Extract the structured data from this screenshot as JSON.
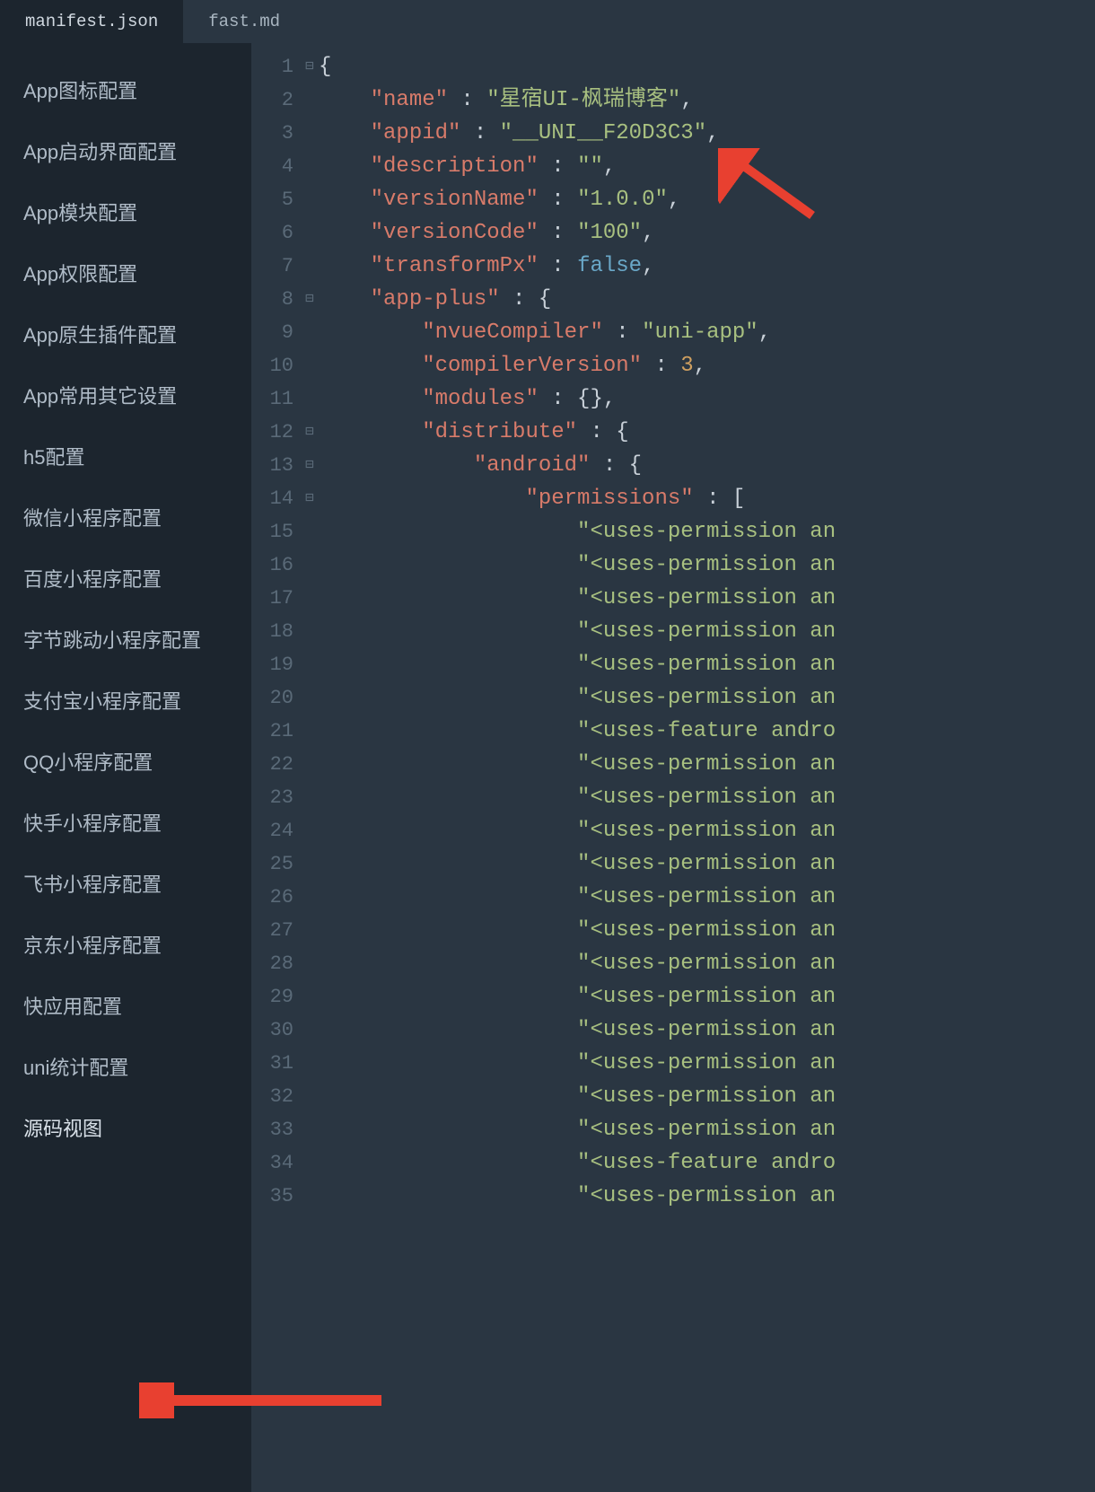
{
  "tabs": [
    {
      "label": "manifest.json",
      "active": true
    },
    {
      "label": "fast.md",
      "active": false
    }
  ],
  "sidebar": {
    "items": [
      "App图标配置",
      "App启动界面配置",
      "App模块配置",
      "App权限配置",
      "App原生插件配置",
      "App常用其它设置",
      "h5配置",
      "微信小程序配置",
      "百度小程序配置",
      "字节跳动小程序配置",
      "支付宝小程序配置",
      "QQ小程序配置",
      "快手小程序配置",
      "飞书小程序配置",
      "京东小程序配置",
      "快应用配置",
      "uni统计配置",
      "源码视图"
    ],
    "active_index": 17
  },
  "code": {
    "lines": [
      {
        "n": 1,
        "fold": "⊟",
        "indent": 0,
        "t": [
          {
            "c": "cp",
            "v": "{"
          }
        ]
      },
      {
        "n": 2,
        "indent": 1,
        "t": [
          {
            "c": "ck",
            "v": "\"name\""
          },
          {
            "c": "cp",
            "v": " : "
          },
          {
            "c": "cs",
            "v": "\"星宿UI-枫瑞博客\""
          },
          {
            "c": "cp",
            "v": ","
          }
        ]
      },
      {
        "n": 3,
        "indent": 1,
        "t": [
          {
            "c": "ck",
            "v": "\"appid\""
          },
          {
            "c": "cp",
            "v": " : "
          },
          {
            "c": "cs",
            "v": "\"__UNI__F20D3C3\""
          },
          {
            "c": "cp",
            "v": ","
          }
        ]
      },
      {
        "n": 4,
        "indent": 1,
        "t": [
          {
            "c": "ck",
            "v": "\"description\""
          },
          {
            "c": "cp",
            "v": " : "
          },
          {
            "c": "cs",
            "v": "\"\""
          },
          {
            "c": "cp",
            "v": ","
          }
        ]
      },
      {
        "n": 5,
        "indent": 1,
        "t": [
          {
            "c": "ck",
            "v": "\"versionName\""
          },
          {
            "c": "cp",
            "v": " : "
          },
          {
            "c": "cs",
            "v": "\"1.0.0\""
          },
          {
            "c": "cp",
            "v": ","
          }
        ]
      },
      {
        "n": 6,
        "indent": 1,
        "t": [
          {
            "c": "ck",
            "v": "\"versionCode\""
          },
          {
            "c": "cp",
            "v": " : "
          },
          {
            "c": "cs",
            "v": "\"100\""
          },
          {
            "c": "cp",
            "v": ","
          }
        ]
      },
      {
        "n": 7,
        "indent": 1,
        "t": [
          {
            "c": "ck",
            "v": "\"transformPx\""
          },
          {
            "c": "cp",
            "v": " : "
          },
          {
            "c": "cb",
            "v": "false"
          },
          {
            "c": "cp",
            "v": ","
          }
        ]
      },
      {
        "n": 8,
        "fold": "⊟",
        "indent": 1,
        "t": [
          {
            "c": "ck",
            "v": "\"app-plus\""
          },
          {
            "c": "cp",
            "v": " : {"
          }
        ]
      },
      {
        "n": 9,
        "indent": 2,
        "t": [
          {
            "c": "ck",
            "v": "\"nvueCompiler\""
          },
          {
            "c": "cp",
            "v": " : "
          },
          {
            "c": "cs",
            "v": "\"uni-app\""
          },
          {
            "c": "cp",
            "v": ","
          }
        ]
      },
      {
        "n": 10,
        "indent": 2,
        "t": [
          {
            "c": "ck",
            "v": "\"compilerVersion\""
          },
          {
            "c": "cp",
            "v": " : "
          },
          {
            "c": "cn",
            "v": "3"
          },
          {
            "c": "cp",
            "v": ","
          }
        ]
      },
      {
        "n": 11,
        "indent": 2,
        "t": [
          {
            "c": "ck",
            "v": "\"modules\""
          },
          {
            "c": "cp",
            "v": " : {},"
          }
        ]
      },
      {
        "n": 12,
        "fold": "⊟",
        "indent": 2,
        "t": [
          {
            "c": "ck",
            "v": "\"distribute\""
          },
          {
            "c": "cp",
            "v": " : {"
          }
        ]
      },
      {
        "n": 13,
        "fold": "⊟",
        "indent": 3,
        "t": [
          {
            "c": "ck",
            "v": "\"android\""
          },
          {
            "c": "cp",
            "v": " : {"
          }
        ]
      },
      {
        "n": 14,
        "fold": "⊟",
        "indent": 4,
        "t": [
          {
            "c": "ck",
            "v": "\"permissions\""
          },
          {
            "c": "cp",
            "v": " : ["
          }
        ]
      },
      {
        "n": 15,
        "indent": 5,
        "t": [
          {
            "c": "cs",
            "v": "\"<uses-permission an"
          }
        ]
      },
      {
        "n": 16,
        "indent": 5,
        "t": [
          {
            "c": "cs",
            "v": "\"<uses-permission an"
          }
        ]
      },
      {
        "n": 17,
        "indent": 5,
        "t": [
          {
            "c": "cs",
            "v": "\"<uses-permission an"
          }
        ]
      },
      {
        "n": 18,
        "indent": 5,
        "t": [
          {
            "c": "cs",
            "v": "\"<uses-permission an"
          }
        ]
      },
      {
        "n": 19,
        "indent": 5,
        "t": [
          {
            "c": "cs",
            "v": "\"<uses-permission an"
          }
        ]
      },
      {
        "n": 20,
        "indent": 5,
        "t": [
          {
            "c": "cs",
            "v": "\"<uses-permission an"
          }
        ]
      },
      {
        "n": 21,
        "indent": 5,
        "t": [
          {
            "c": "cs",
            "v": "\"<uses-feature andro"
          }
        ]
      },
      {
        "n": 22,
        "indent": 5,
        "t": [
          {
            "c": "cs",
            "v": "\"<uses-permission an"
          }
        ]
      },
      {
        "n": 23,
        "indent": 5,
        "t": [
          {
            "c": "cs",
            "v": "\"<uses-permission an"
          }
        ]
      },
      {
        "n": 24,
        "indent": 5,
        "t": [
          {
            "c": "cs",
            "v": "\"<uses-permission an"
          }
        ]
      },
      {
        "n": 25,
        "indent": 5,
        "t": [
          {
            "c": "cs",
            "v": "\"<uses-permission an"
          }
        ]
      },
      {
        "n": 26,
        "indent": 5,
        "t": [
          {
            "c": "cs",
            "v": "\"<uses-permission an"
          }
        ]
      },
      {
        "n": 27,
        "indent": 5,
        "t": [
          {
            "c": "cs",
            "v": "\"<uses-permission an"
          }
        ]
      },
      {
        "n": 28,
        "indent": 5,
        "t": [
          {
            "c": "cs",
            "v": "\"<uses-permission an"
          }
        ]
      },
      {
        "n": 29,
        "indent": 5,
        "t": [
          {
            "c": "cs",
            "v": "\"<uses-permission an"
          }
        ]
      },
      {
        "n": 30,
        "indent": 5,
        "t": [
          {
            "c": "cs",
            "v": "\"<uses-permission an"
          }
        ]
      },
      {
        "n": 31,
        "indent": 5,
        "t": [
          {
            "c": "cs",
            "v": "\"<uses-permission an"
          }
        ]
      },
      {
        "n": 32,
        "indent": 5,
        "t": [
          {
            "c": "cs",
            "v": "\"<uses-permission an"
          }
        ]
      },
      {
        "n": 33,
        "indent": 5,
        "t": [
          {
            "c": "cs",
            "v": "\"<uses-permission an"
          }
        ]
      },
      {
        "n": 34,
        "indent": 5,
        "t": [
          {
            "c": "cs",
            "v": "\"<uses-feature andro"
          }
        ]
      },
      {
        "n": 35,
        "indent": 5,
        "t": [
          {
            "c": "cs",
            "v": "\"<uses-permission an"
          }
        ]
      }
    ]
  }
}
